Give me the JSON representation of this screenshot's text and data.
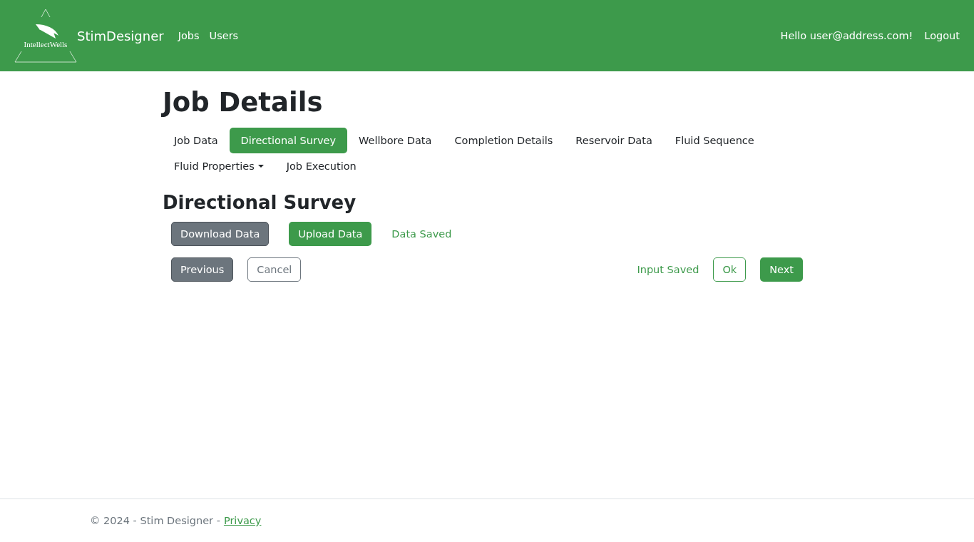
{
  "header": {
    "logo_text": "IntellectWells",
    "brand": "StimDesigner",
    "nav": [
      "Jobs",
      "Users"
    ],
    "greeting": "Hello user@address.com!",
    "logout": "Logout"
  },
  "page_title": "Job Details",
  "tabs": [
    {
      "label": "Job Data",
      "selected": false
    },
    {
      "label": "Directional Survey",
      "selected": true
    },
    {
      "label": "Wellbore Data",
      "selected": false
    },
    {
      "label": "Completion Details",
      "selected": false
    },
    {
      "label": "Reservoir Data",
      "selected": false
    },
    {
      "label": "Fluid Sequence",
      "selected": false
    },
    {
      "label": "Fluid Properties",
      "selected": false,
      "kind": "dropdown"
    },
    {
      "label": "Job Execution",
      "selected": false
    }
  ],
  "section_title": "Directional Survey",
  "data_actions": [
    {
      "kind": "secondary",
      "label": "Download Data"
    },
    {
      "kind": "primary",
      "label": "Upload Data"
    },
    {
      "kind": "status",
      "label": "Data Saved"
    }
  ],
  "nav_left": [
    {
      "kind": "secondary",
      "label": "Previous"
    },
    {
      "kind": "outline",
      "label": "Cancel"
    }
  ],
  "nav_right": [
    {
      "kind": "status",
      "label": "Input Saved"
    },
    {
      "kind": "outline-green",
      "label": "Ok"
    },
    {
      "kind": "primary",
      "label": "Next"
    }
  ],
  "footer": {
    "text": "© 2024 - Stim Designer -",
    "link": "Privacy"
  }
}
